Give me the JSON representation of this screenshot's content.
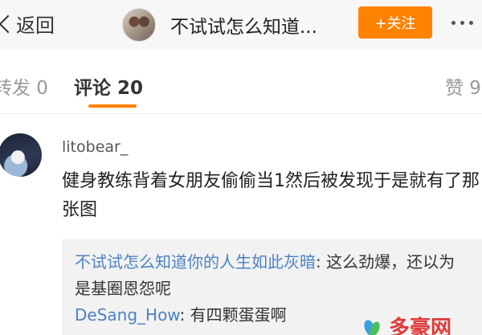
{
  "header": {
    "back_label": "返回",
    "user_name": "不试试怎么知道...",
    "follow_label": "+关注",
    "more_label": "..."
  },
  "tabs": {
    "repost": "转发 0",
    "comment": "评论 20",
    "like": "赞 9"
  },
  "comment": {
    "user": "litobear_",
    "text": "健身教练背着女朋友偷偷当1然后被发现于是就有了那张图"
  },
  "replies": [
    {
      "name": "不试试怎么知道你的人生如此灰暗",
      "text": ": 这么劲爆，还以为是基圈恩怨呢"
    },
    {
      "name": "DeSang_How",
      "text": ": 有四颗蛋蛋啊"
    }
  ],
  "watermark": {
    "text": "多豪网"
  },
  "colors": {
    "accent": "#ff8200",
    "link": "#4c82c0",
    "reply_bg": "#f2f2f2"
  }
}
